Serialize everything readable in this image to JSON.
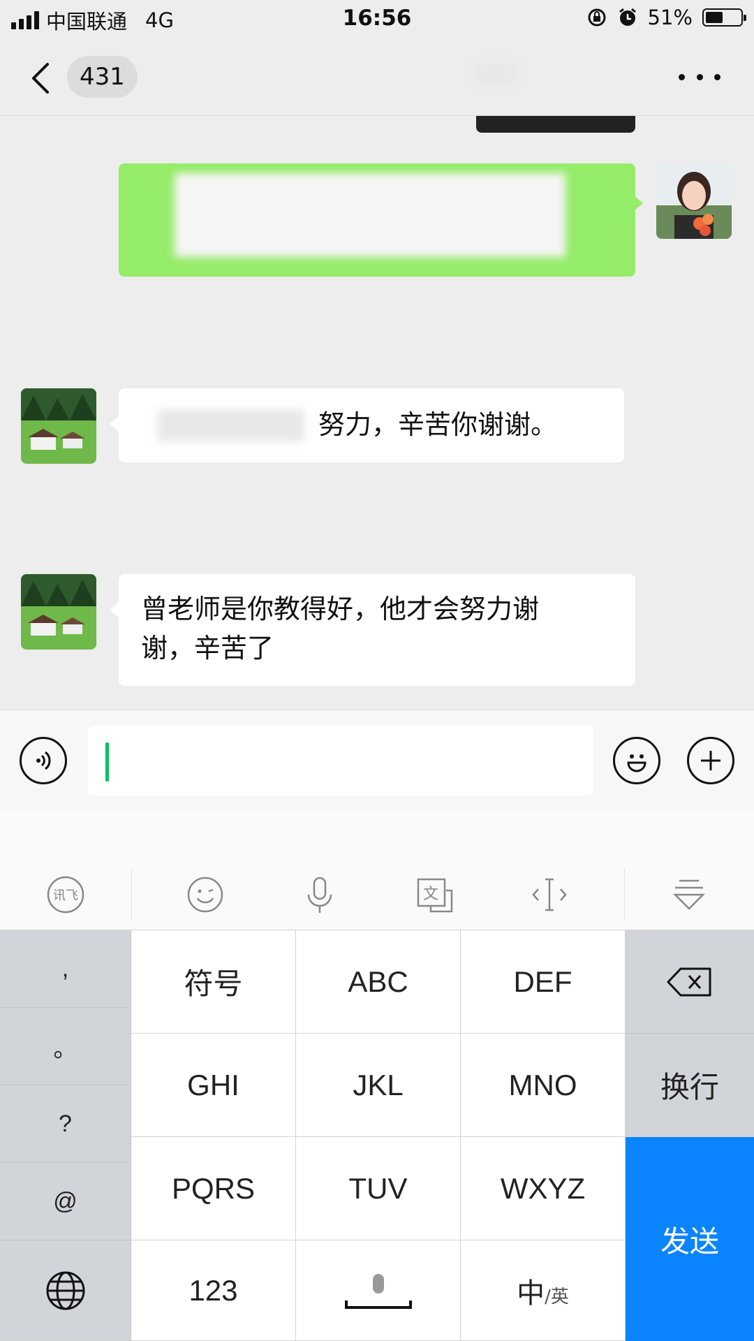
{
  "status_bar": {
    "carrier": "中国联通",
    "network": "4G",
    "time": "16:56",
    "battery": "51%",
    "battery_level": 0.51
  },
  "nav": {
    "unread_count": "431",
    "title": ""
  },
  "messages": [
    {
      "side": "right",
      "text": "",
      "bubble_color": "#95ec69"
    },
    {
      "side": "left",
      "text": "努力，辛苦你谢谢。"
    },
    {
      "side": "left",
      "text_line1": "曾老师是你教得好，他才会努力谢",
      "text_line2": "谢，辛苦了"
    }
  ],
  "input": {
    "value": "",
    "placeholder": ""
  },
  "keyboard": {
    "punct": [
      ",",
      "。",
      "?",
      "@"
    ],
    "rows": [
      [
        "符号",
        "ABC",
        "DEF"
      ],
      [
        "GHI",
        "JKL",
        "MNO"
      ],
      [
        "PQRS",
        "TUV",
        "WXYZ"
      ]
    ],
    "num_key": "123",
    "lang_key_main": "中",
    "lang_key_sub": "/英",
    "newline_key": "换行",
    "send_key": "发送",
    "send_color": "#0a84ff",
    "toolbar_icons": [
      "xunfei-logo-icon",
      "emoji-icon",
      "mic-icon",
      "translate-icon",
      "cursor-move-icon",
      "collapse-keyboard-icon"
    ]
  },
  "colors": {
    "background": "#ededed",
    "accent_green": "#07c160"
  }
}
